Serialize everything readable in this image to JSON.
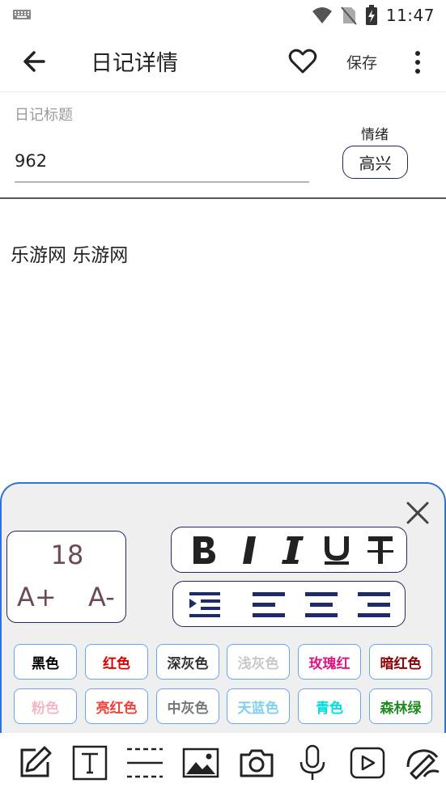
{
  "status_bar": {
    "time": "11:47"
  },
  "app_bar": {
    "title": "日记详情",
    "save_label": "保存"
  },
  "diary": {
    "title_hint": "日记标题",
    "title_value": "962",
    "mood_label": "情绪",
    "mood_value": "高兴",
    "content": "乐游网 乐游网"
  },
  "format_panel": {
    "font_size": "18",
    "increase_label": "A+",
    "decrease_label": "A-",
    "colors": [
      {
        "label": "黑色",
        "color": "#000000"
      },
      {
        "label": "红色",
        "color": "#e00000"
      },
      {
        "label": "深灰色",
        "color": "#333333"
      },
      {
        "label": "浅灰色",
        "color": "#c8c8c8"
      },
      {
        "label": "玫瑰红",
        "color": "#e0157f"
      },
      {
        "label": "暗红色",
        "color": "#8b0000"
      },
      {
        "label": "粉色",
        "color": "#f5b7c5"
      },
      {
        "label": "亮红色",
        "color": "#f0413c"
      },
      {
        "label": "中灰色",
        "color": "#777777"
      },
      {
        "label": "天蓝色",
        "color": "#7fd0ee"
      },
      {
        "label": "青色",
        "color": "#00dede"
      },
      {
        "label": "森林绿",
        "color": "#228b22"
      }
    ]
  },
  "toolbar": {
    "icons": [
      "pencil-icon",
      "text-icon",
      "divider-icon",
      "image-icon",
      "camera-icon",
      "mic-icon",
      "video-icon",
      "paint-icon"
    ]
  }
}
